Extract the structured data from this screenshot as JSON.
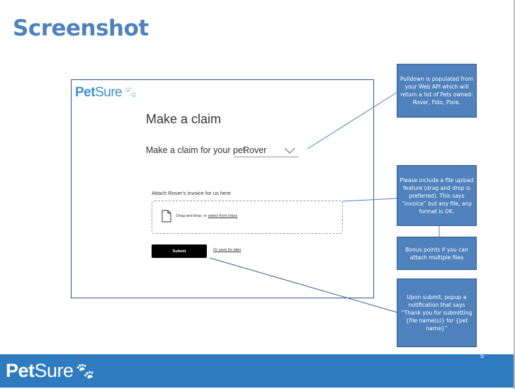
{
  "slide": {
    "title": "Screenshot",
    "page_number": "5"
  },
  "mockup": {
    "logo_bold": "Pet",
    "logo_light": "Sure",
    "heading": "Make a claim",
    "pet_label": "Make a claim for your pet",
    "pet_selected": "Rover",
    "attach_label": "Attach Rover's invoice for us here",
    "drop_text": "Drag and drop, or ",
    "drop_link": "select from inbox",
    "submit_label": "Submit",
    "save_link": "Or save for later"
  },
  "callouts": [
    "Pulldown is populated from your Web API which will return a list of Pets owned: Rover, Fido, Pixie.",
    "Please include a file upload feature (drag and drop is preferred).  This says “invoice” but any file, any format is OK.",
    "Bonus points if you can attach multiple files",
    "Upon submit, popup a notification that says “Thank you for submitting {file name(s)} for {pet name}”"
  ],
  "footer": {
    "logo_bold": "Pet",
    "logo_light": "Sure"
  },
  "colors": {
    "accent": "#4F81BD",
    "footer": "#2E7BBF",
    "logo": "#3A8FD0"
  }
}
